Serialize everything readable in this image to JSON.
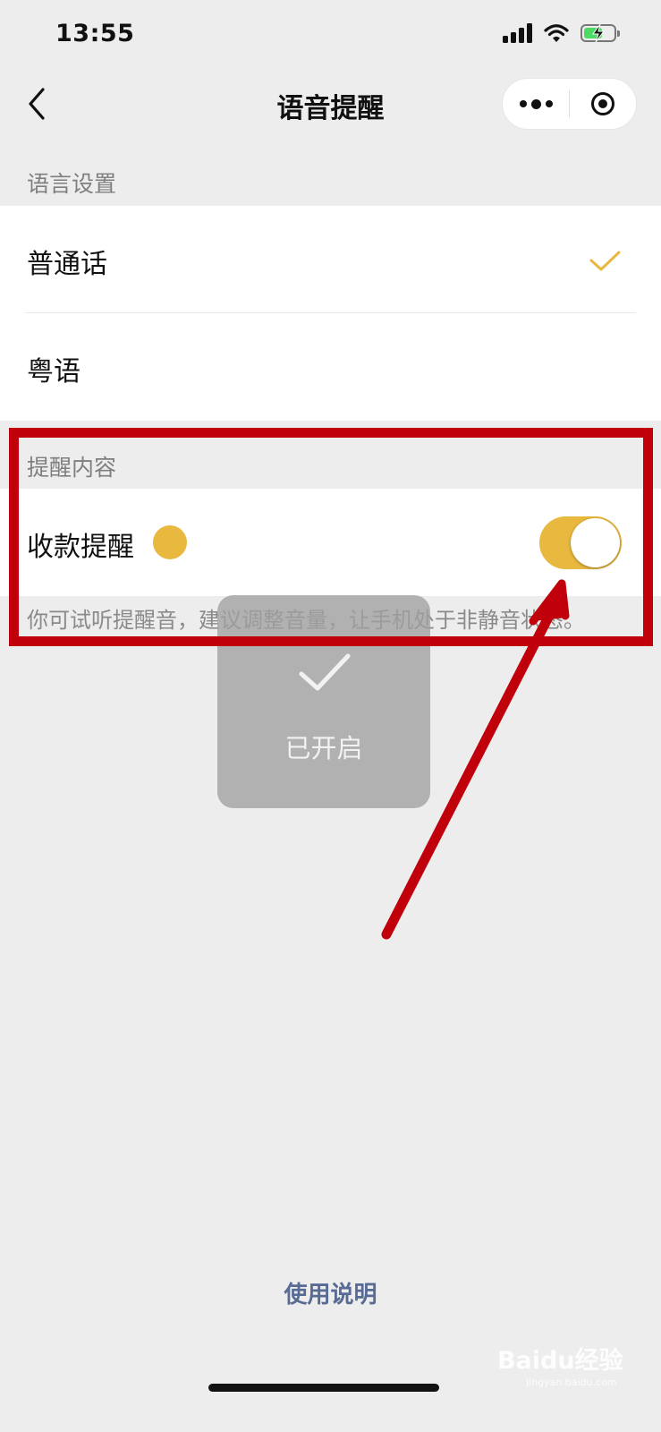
{
  "status_bar": {
    "time": "13:55",
    "icons": [
      "signal-icon",
      "wifi-icon",
      "battery-charging-icon"
    ]
  },
  "nav": {
    "title": "语音提醒",
    "back_icon": "chevron-left-icon",
    "more_icon": "more-icon",
    "close_icon": "target-icon"
  },
  "language_section": {
    "label": "语言设置",
    "options": [
      {
        "label": "普通话",
        "selected": true
      },
      {
        "label": "粤语",
        "selected": false
      }
    ]
  },
  "reminder_section": {
    "label": "提醒内容",
    "items": [
      {
        "label": "收款提醒",
        "toggle_on": true
      }
    ],
    "hint": "你可试听提醒音，建议调整音量，让手机处于非静音状态。"
  },
  "toast": {
    "text": "已开启",
    "icon": "check-icon"
  },
  "footer": {
    "help_link": "使用说明"
  },
  "watermark": {
    "text": "Baidu经验",
    "sub": "jingyan.baidu.com"
  },
  "colors": {
    "accent": "#e8b83f",
    "annotation_red": "#c0000a",
    "link": "#576b95",
    "background": "#ededed"
  }
}
